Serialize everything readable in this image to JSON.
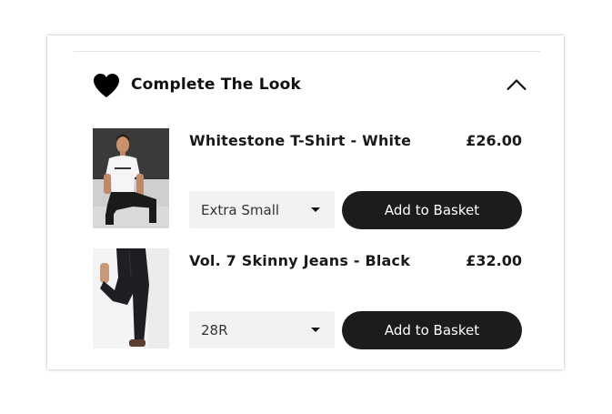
{
  "section": {
    "title": "Complete The Look",
    "heart_icon": "heart-icon",
    "collapse_icon": "chevron-up-icon"
  },
  "products": [
    {
      "name": "Whitestone T-Shirt - White",
      "price": "£26.00",
      "size": "Extra Small",
      "button": "Add to Basket"
    },
    {
      "name": "Vol. 7 Skinny Jeans - Black",
      "price": "£32.00",
      "size": "28R",
      "button": "Add to Basket"
    }
  ],
  "colors": {
    "button_bg": "#1c1c1c",
    "select_bg": "#f2f2f2",
    "text": "#1a1a1a"
  }
}
